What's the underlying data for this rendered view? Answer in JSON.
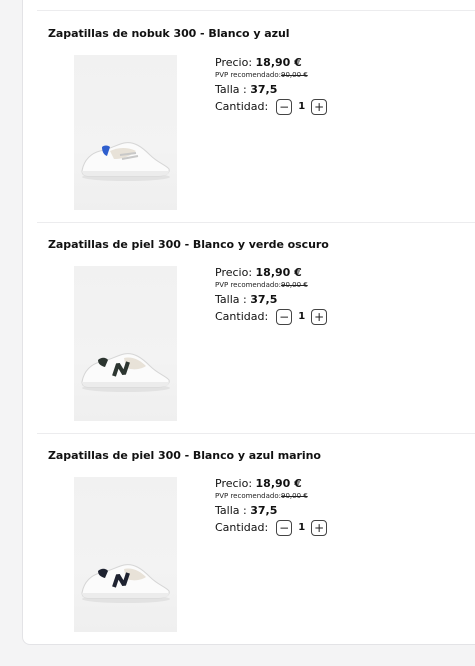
{
  "products": [
    {
      "title": "Zapatillas de nobuk 300 - Blanco y azul",
      "image_icon": "sneaker-white-blue-image",
      "accent_color": "#2f5fce",
      "price_label": "Precio:",
      "price_value": "18,90 €",
      "pvp_label": "PVP recomendado:",
      "pvp_value": "90,00 €",
      "size_label": "Talla :",
      "size_value": "37,5",
      "qty_label": "Cantidad:",
      "qty_minus": "−",
      "qty_value": "1",
      "qty_plus": "+"
    },
    {
      "title": "Zapatillas de piel 300 - Blanco y verde oscuro",
      "image_icon": "sneaker-white-darkgreen-image",
      "accent_color": "#2c3530",
      "price_label": "Precio:",
      "price_value": "18,90 €",
      "pvp_label": "PVP recomendado:",
      "pvp_value": "90,00 €",
      "size_label": "Talla :",
      "size_value": "37,5",
      "qty_label": "Cantidad:",
      "qty_minus": "−",
      "qty_value": "1",
      "qty_plus": "+"
    },
    {
      "title": "Zapatillas de piel 300 - Blanco y azul marino",
      "image_icon": "sneaker-white-navy-image",
      "accent_color": "#1e2230",
      "price_label": "Precio:",
      "price_value": "18,90 €",
      "pvp_label": "PVP recomendado:",
      "pvp_value": "90,00 €",
      "size_label": "Talla :",
      "size_value": "37,5",
      "qty_label": "Cantidad:",
      "qty_minus": "−",
      "qty_value": "1",
      "qty_plus": "+"
    }
  ]
}
